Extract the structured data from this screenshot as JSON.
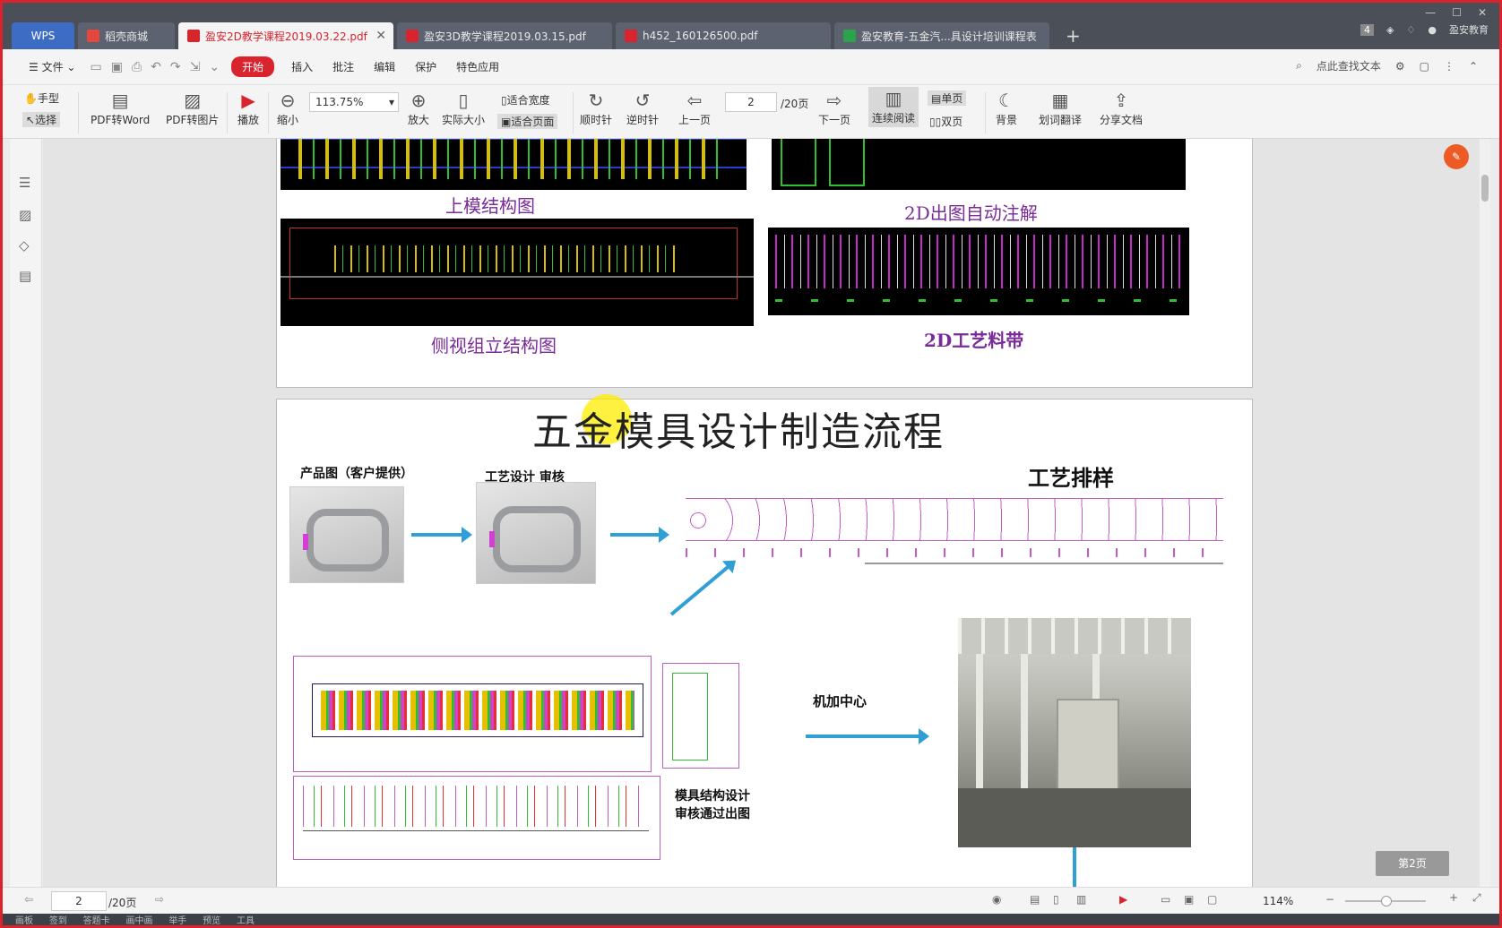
{
  "tabs": {
    "wps": "WPS",
    "home": "稻壳商城",
    "docs": [
      "盈安2D教学课程2019.03.22.pdf",
      "盈安3D教学课程2019.03.15.pdf",
      "h452_160126500.pdf",
      "盈安教育-五金汽...具设计培训课程表"
    ],
    "user": "盈安教育",
    "badge": "4"
  },
  "menu": {
    "file": "文件",
    "items": [
      "开始",
      "插入",
      "批注",
      "编辑",
      "保护",
      "特色应用"
    ],
    "search": "点此查找文本"
  },
  "ribbon": {
    "hand": "手型",
    "select": "选择",
    "pdf_word": "PDF转Word",
    "pdf_img": "PDF转图片",
    "play": "播放",
    "zoom_out": "缩小",
    "zoom_value": "113.75%",
    "zoom_in": "放大",
    "actual": "实际大小",
    "fit_width": "适合宽度",
    "fit_page": "适合页面",
    "cw": "顺时针",
    "ccw": "逆时针",
    "prev": "上一页",
    "page_value": "2",
    "page_total": "/20页",
    "next": "下一页",
    "continuous": "连续阅读",
    "single": "单页",
    "double": "双页",
    "background": "背景",
    "translate": "划词翻译",
    "share": "分享文档"
  },
  "page1": {
    "cap_upper": "上模结构图",
    "cap_auto": "2D出图自动注解",
    "cap_side": "侧视组立结构图",
    "cap_strip": "2D工艺料带"
  },
  "page2": {
    "title": "五金模具设计制造流程",
    "product": "产品图（客户提供）",
    "process_review": "工艺设计  审核",
    "layout": "工艺排样",
    "machining": "机加中心",
    "design_line1": "模具结构设计",
    "design_line2": "审核通过出图",
    "badge": "第2页"
  },
  "status": {
    "page_value": "2",
    "page_total": "/20页",
    "zoom": "114%"
  },
  "taskbar": [
    "画板",
    "签到",
    "答题卡",
    "画中画",
    "举手",
    "预览",
    "工具"
  ]
}
